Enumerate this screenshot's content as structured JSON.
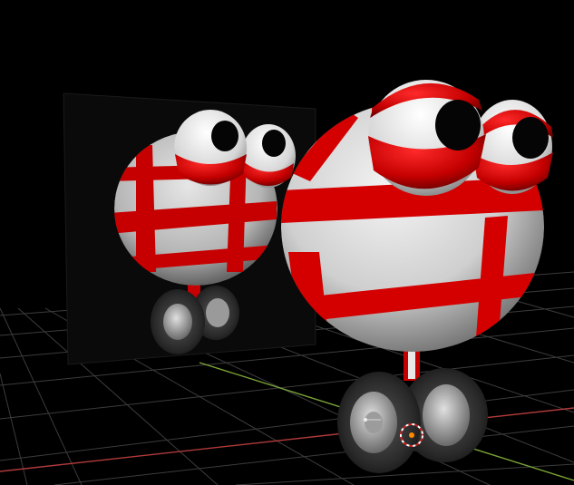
{
  "app": {
    "view": "3D viewport",
    "background_color": "#000000"
  },
  "scene": {
    "objects": [
      {
        "name": "robot-character",
        "description_icon": "sphere-robot",
        "body_color": "#d9d9d9",
        "stripe_color": "#d40000"
      },
      {
        "name": "mirror-panel",
        "surface_color": "#0a0a0a"
      },
      {
        "name": "grid-floor",
        "line_color": "#3c3c3c"
      }
    ],
    "axes": {
      "x_axis_color": "#b03a3a",
      "y_axis_color": "#7aa336"
    },
    "cursor": {
      "name": "3d-cursor-icon",
      "ring_color": "#ffffff",
      "center_color": "#ff8800"
    }
  }
}
